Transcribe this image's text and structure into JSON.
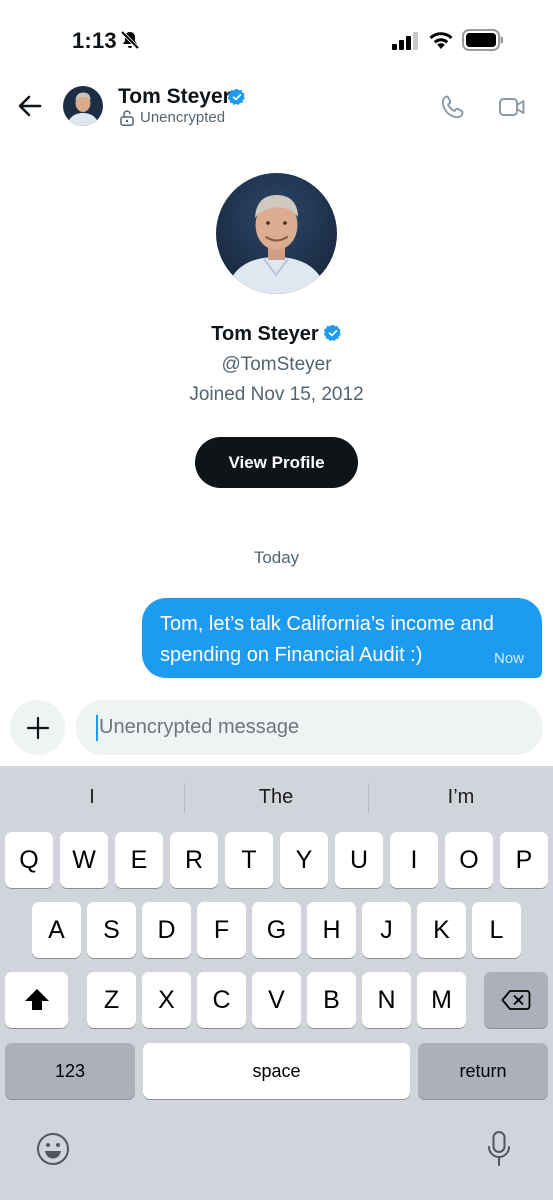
{
  "status_bar": {
    "time": "1:13"
  },
  "header": {
    "name": "Tom Steyer",
    "encryption": "Unencrypted"
  },
  "profile": {
    "name": "Tom Steyer",
    "handle": "@TomSteyer",
    "joined": "Joined Nov 15, 2012",
    "view_profile_label": "View Profile"
  },
  "conversation": {
    "day": "Today",
    "messages": [
      {
        "text": "Tom, let’s talk California’s income and spending on Financial Audit :)",
        "time": "Now"
      }
    ]
  },
  "composer": {
    "placeholder": "Unencrypted message"
  },
  "keyboard": {
    "suggestions": [
      "I",
      "The",
      "I’m"
    ],
    "row1": [
      "Q",
      "W",
      "E",
      "R",
      "T",
      "Y",
      "U",
      "I",
      "O",
      "P"
    ],
    "row2": [
      "A",
      "S",
      "D",
      "F",
      "G",
      "H",
      "J",
      "K",
      "L"
    ],
    "row3": [
      "Z",
      "X",
      "C",
      "V",
      "B",
      "N",
      "M"
    ],
    "numbers_label": "123",
    "space_label": "space",
    "return_label": "return"
  },
  "colors": {
    "accent": "#1d9bf0",
    "text": "#0f1419",
    "muted": "#536471",
    "keyboard_bg": "#d1d4db"
  }
}
